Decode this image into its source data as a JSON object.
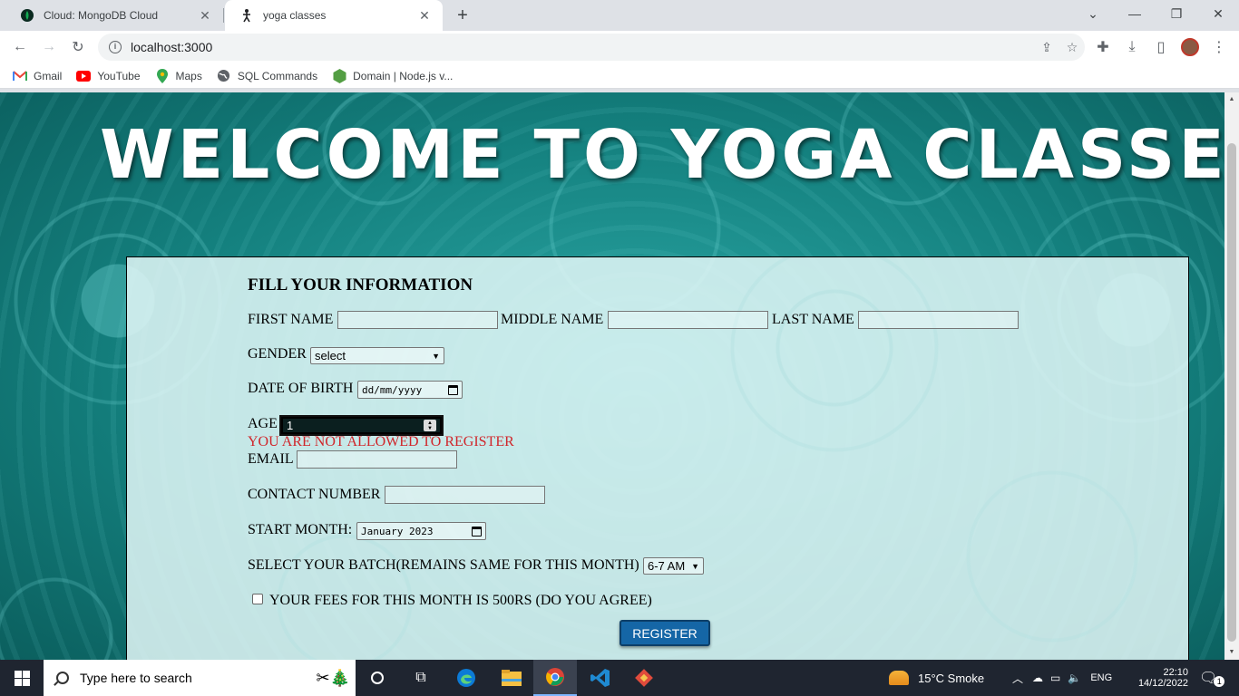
{
  "browser": {
    "tabs": [
      {
        "title": "Cloud: MongoDB Cloud",
        "active": false
      },
      {
        "title": "yoga classes",
        "active": true
      }
    ],
    "url": "localhost:3000",
    "bookmarks": [
      {
        "label": "Gmail",
        "icon": "gmail-icon"
      },
      {
        "label": "YouTube",
        "icon": "youtube-icon"
      },
      {
        "label": "Maps",
        "icon": "maps-icon"
      },
      {
        "label": "SQL Commands",
        "icon": "globe-icon"
      },
      {
        "label": "Domain | Node.js v...",
        "icon": "nodejs-icon"
      }
    ]
  },
  "page": {
    "heading": "WELCOME TO YOGA  CLASSES",
    "form": {
      "title": "FILL YOUR INFORMATION",
      "first_name_label": "FIRST NAME",
      "middle_name_label": "MIDDLE NAME",
      "last_name_label": "LAST NAME",
      "gender_label": "GENDER",
      "gender_value": "select",
      "dob_label": "DATE OF BIRTH",
      "dob_value": "dd/mm/yyyy",
      "age_label": "AGE",
      "age_value": "1",
      "age_error": "YOU ARE NOT ALLOWED TO REGISTER",
      "email_label": "EMAIL",
      "contact_label": "CONTACT NUMBER",
      "start_month_label": "START MONTH:",
      "start_month_value": "January 2023",
      "batch_label": "SELECT YOUR BATCH(REMAINS SAME FOR THIS MONTH)",
      "batch_value": "6-7 AM",
      "fees_label": "YOUR FEES FOR THIS MONTH IS 500RS (DO YOU AGREE)",
      "register_label": "REGISTER"
    }
  },
  "taskbar": {
    "search_placeholder": "Type here to search",
    "weather": "15°C  Smoke",
    "language": "ENG",
    "time": "22:10",
    "date": "14/12/2022",
    "notification_count": "1"
  },
  "colors": {
    "error": "#d0262b",
    "register_button": "#1566a6",
    "page_background": "#14807e"
  }
}
